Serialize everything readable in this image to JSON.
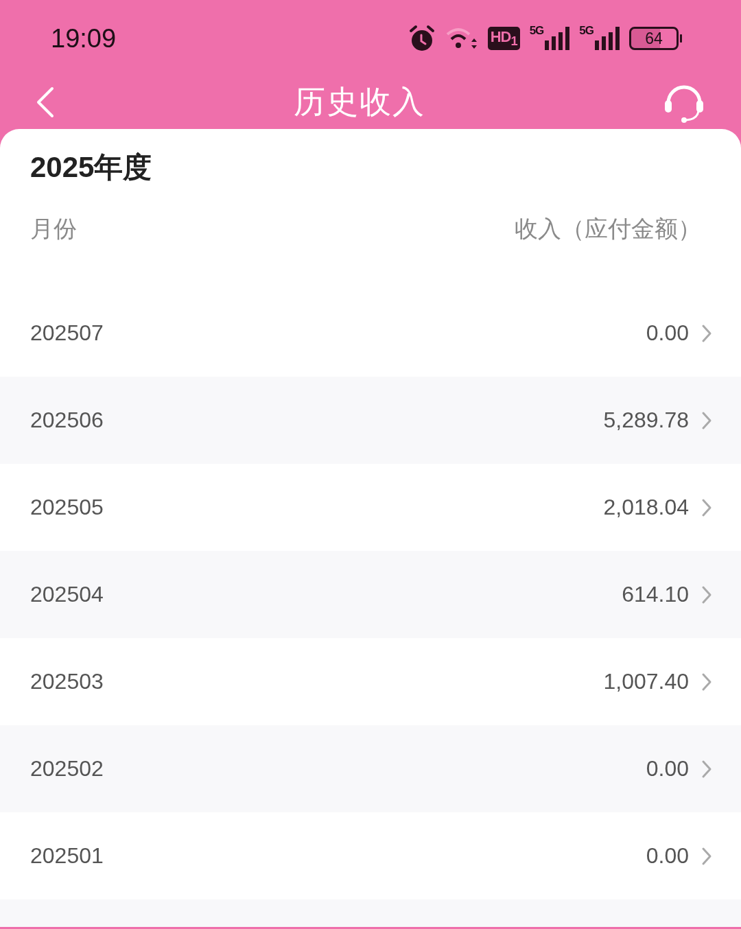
{
  "status_bar": {
    "time": "19:09",
    "hd_badge": "HD$_{1}$",
    "sim_1": "5G",
    "sim_2": "5G",
    "battery": "64"
  },
  "header": {
    "title": "历史收入"
  },
  "year_title": "2025年度",
  "table": {
    "columns": [
      "月份",
      "收入（应付金额）"
    ],
    "rows": [
      {
        "month": "202507",
        "amount": "0.00"
      },
      {
        "month": "202506",
        "amount": "5,289.78"
      },
      {
        "month": "202505",
        "amount": "2,018.04"
      },
      {
        "month": "202504",
        "amount": "614.10"
      },
      {
        "month": "202503",
        "amount": "1,007.40"
      },
      {
        "month": "202502",
        "amount": "0.00"
      },
      {
        "month": "202501",
        "amount": "0.00"
      }
    ]
  }
}
